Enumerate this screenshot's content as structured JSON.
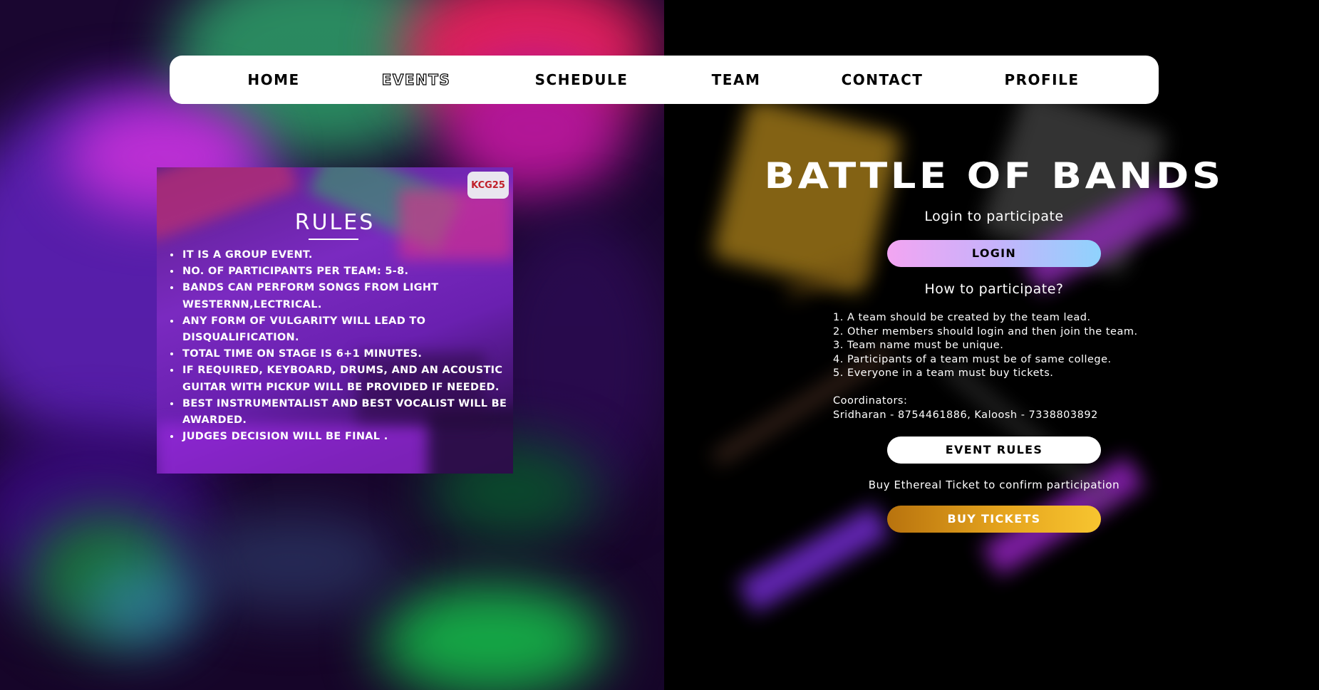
{
  "nav": {
    "items": [
      {
        "label": "HOME"
      },
      {
        "label": "EVENTS"
      },
      {
        "label": "SCHEDULE"
      },
      {
        "label": "TEAM"
      },
      {
        "label": "CONTACT"
      },
      {
        "label": "PROFILE"
      }
    ],
    "active": "EVENTS"
  },
  "poster": {
    "logo_text": "KCG25",
    "title": "RULES",
    "rules": [
      "IT IS A GROUP EVENT.",
      "NO. OF PARTICIPANTS PER TEAM: 5-8.",
      "BANDS CAN PERFORM SONGS FROM LIGHT WESTERNN,LECTRICAL.",
      "ANY FORM OF VULGARITY WILL LEAD TO DISQUALIFICATION.",
      "TOTAL TIME ON STAGE IS 6+1 MINUTES.",
      "IF REQUIRED, KEYBOARD, DRUMS, AND AN ACOUSTIC GUITAR WITH PICKUP WILL BE PROVIDED IF NEEDED.",
      "BEST INSTRUMENTALIST AND BEST VOCALIST WILL BE AWARDED.",
      "JUDGES DECISION WILL BE FINAL ."
    ]
  },
  "event": {
    "title": "BATTLE OF BANDS",
    "login_hint": "Login to participate",
    "login_button": "LOGIN",
    "how_title": "How to participate?",
    "steps": [
      "1. A team should be created by the team lead.",
      "2. Other members should login and then join the team.",
      "3. Team name must be unique.",
      "4. Participants of a team must be of same college.",
      "5. Everyone in a team must buy tickets."
    ],
    "coordinators_label": "Coordinators:",
    "coordinators": "Sridharan - 8754461886, Kaloosh - 7338803892",
    "rules_button": "EVENT RULES",
    "buy_hint": "Buy Ethereal Ticket to confirm participation",
    "buy_button": "BUY TICKETS"
  },
  "colors": {
    "nav_bg": "#ffffff",
    "login_gradient": [
      "#f3a5f2",
      "#8fd3fd"
    ],
    "buy_gradient": [
      "#b8730e",
      "#f7c530"
    ],
    "page_bg": "#000000"
  }
}
